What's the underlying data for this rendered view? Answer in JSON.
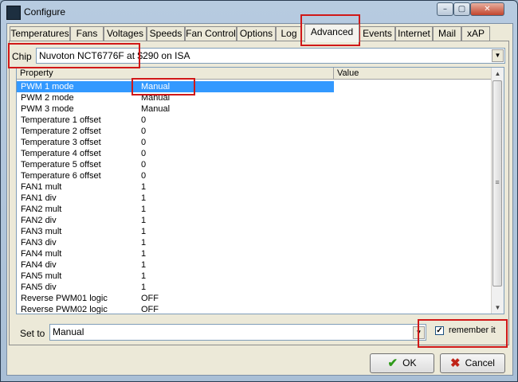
{
  "window": {
    "title": "Configure",
    "controls": {
      "minimize": "–",
      "maximize": "▢",
      "close": "✕"
    }
  },
  "tabs": [
    "Temperatures",
    "Fans",
    "Voltages",
    "Speeds",
    "Fan Control",
    "Options",
    "Log",
    "Advanced",
    "Events",
    "Internet",
    "Mail",
    "xAP"
  ],
  "active_tab": "Advanced",
  "chip": {
    "label": "Chip",
    "value": "Nuvoton NCT6776F at $290 on ISA"
  },
  "grid": {
    "columns": [
      "Property",
      "Value"
    ],
    "selected_row": 0,
    "rows": [
      {
        "property": "PWM 1 mode",
        "value": "Manual"
      },
      {
        "property": "PWM 2 mode",
        "value": "Manual"
      },
      {
        "property": "PWM 3 mode",
        "value": "Manual"
      },
      {
        "property": "Temperature 1 offset",
        "value": "0"
      },
      {
        "property": "Temperature 2 offset",
        "value": "0"
      },
      {
        "property": "Temperature 3 offset",
        "value": "0"
      },
      {
        "property": "Temperature 4 offset",
        "value": "0"
      },
      {
        "property": "Temperature 5 offset",
        "value": "0"
      },
      {
        "property": "Temperature 6 offset",
        "value": "0"
      },
      {
        "property": "FAN1 mult",
        "value": "1"
      },
      {
        "property": "FAN1 div",
        "value": "1"
      },
      {
        "property": "FAN2 mult",
        "value": "1"
      },
      {
        "property": "FAN2 div",
        "value": "1"
      },
      {
        "property": "FAN3 mult",
        "value": "1"
      },
      {
        "property": "FAN3 div",
        "value": "1"
      },
      {
        "property": "FAN4 mult",
        "value": "1"
      },
      {
        "property": "FAN4 div",
        "value": "1"
      },
      {
        "property": "FAN5 mult",
        "value": "1"
      },
      {
        "property": "FAN5 div",
        "value": "1"
      },
      {
        "property": "Reverse PWM01 logic",
        "value": "OFF"
      },
      {
        "property": "Reverse PWM02 logic",
        "value": "OFF"
      }
    ]
  },
  "set_to": {
    "label": "Set to",
    "value": "Manual"
  },
  "remember": {
    "label": "remember it",
    "checked": true,
    "mark": "✓"
  },
  "buttons": {
    "ok": "OK",
    "cancel": "Cancel"
  },
  "icons": {
    "dropdown": "▼",
    "scroll_up": "▲",
    "scroll_down": "▼",
    "grip": "≡",
    "ok": "✔",
    "cancel": "✖"
  },
  "colors": {
    "selection": "#3399ff",
    "annotation": "#d01818"
  }
}
